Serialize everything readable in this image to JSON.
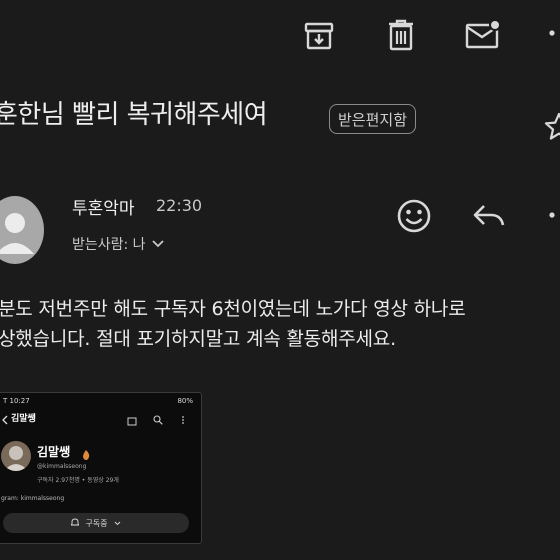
{
  "subject": "훈한님 빨리 복귀해주세여",
  "label": "받은편지함",
  "sender": {
    "name": "투혼악마",
    "time": "22:30",
    "recipient": "받는사람: 나"
  },
  "body": {
    "line1": "분도 저번주만 해도 구독자 6천이였는데 노가다 영상 하나로",
    "line2": "상했습니다. 절대 포기하지말고 계속 활동해주세요."
  },
  "attachment": {
    "status_time": "T 10:27",
    "status_battery": "80%",
    "header_name": "김말쌩",
    "channel_name": "김말쌩",
    "handle": "@kimmalsseong",
    "stats": "구독자 2.97천명 • 동영상 29개",
    "link": "gram: kimmalsseong",
    "subscribe_label": "구독중"
  },
  "icons": {
    "top": [
      "archive-icon",
      "delete-icon",
      "mark-unread-icon",
      "more-vert-icon"
    ],
    "actions": [
      "emoji-icon",
      "reply-icon",
      "more-vert-icon"
    ]
  }
}
